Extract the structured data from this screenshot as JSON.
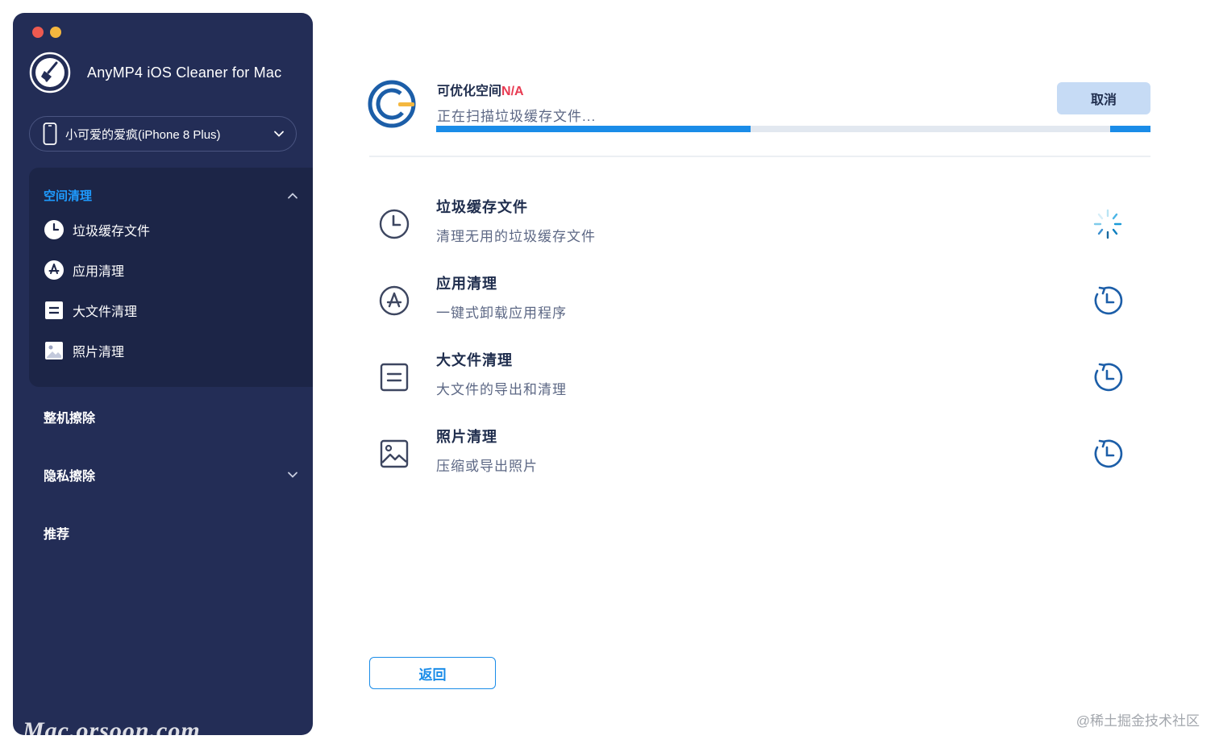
{
  "app": {
    "title": "AnyMP4 iOS Cleaner for Mac"
  },
  "device": {
    "name": "小可爱的爱疯(iPhone 8 Plus)"
  },
  "sidebar": {
    "group_title": "空间清理",
    "items": [
      {
        "label": "垃圾缓存文件",
        "icon": "clock-icon"
      },
      {
        "label": "应用清理",
        "icon": "app-store-icon"
      },
      {
        "label": "大文件清理",
        "icon": "document-icon"
      },
      {
        "label": "照片清理",
        "icon": "photo-icon"
      }
    ],
    "sections": [
      {
        "label": "整机擦除"
      },
      {
        "label": "隐私擦除"
      },
      {
        "label": "推荐"
      }
    ]
  },
  "scan": {
    "space_label": "可优化空间",
    "space_value": "N/A",
    "status": "正在扫描垃圾缓存文件...",
    "cancel_label": "取消",
    "progress": 0.44
  },
  "tasks": [
    {
      "title": "垃圾缓存文件",
      "desc": "清理无用的垃圾缓存文件",
      "icon": "clock-icon",
      "status": "scanning"
    },
    {
      "title": "应用清理",
      "desc": "一键式卸载应用程序",
      "icon": "app-store-icon",
      "status": "pending"
    },
    {
      "title": "大文件清理",
      "desc": "大文件的导出和清理",
      "icon": "document-icon",
      "status": "pending"
    },
    {
      "title": "照片清理",
      "desc": "压缩或导出照片",
      "icon": "photo-icon",
      "status": "pending"
    }
  ],
  "footer": {
    "back_label": "返回",
    "watermark": "Mac.orsoon.com",
    "credit": "@稀土掘金技术社区"
  },
  "colors": {
    "sidebar_bg": "#232d56",
    "accent": "#1a8ce8",
    "na_red": "#e83b52"
  }
}
